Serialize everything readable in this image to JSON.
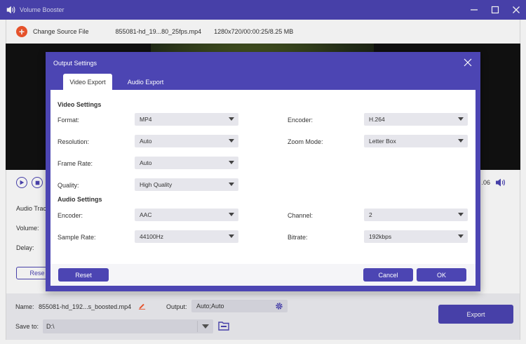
{
  "app": {
    "title": "Volume Booster",
    "source": {
      "change_label": "Change Source File",
      "file_name": "855081-hd_19...80_25fps.mp4",
      "file_meta": "1280x720/00:00:25/8.25 MB"
    },
    "controls": {
      "time_right": ".06"
    },
    "settings": {
      "audio_track_label": "Audio Trac",
      "volume_label": "Volume:",
      "delay_label": "Delay:",
      "reset_label": "Rese"
    },
    "bottom": {
      "name_label": "Name:",
      "name_value": "855081-hd_192...s_boosted.mp4",
      "output_label": "Output:",
      "output_value": "Auto;Auto",
      "saveto_label": "Save to:",
      "saveto_value": "D:\\",
      "export_label": "Export"
    }
  },
  "dialog": {
    "title": "Output Settings",
    "tabs": [
      {
        "label": "Video Export",
        "active": true
      },
      {
        "label": "Audio Export",
        "active": false
      }
    ],
    "video_settings": {
      "title": "Video Settings",
      "format": {
        "label": "Format:",
        "value": "MP4"
      },
      "encoder": {
        "label": "Encoder:",
        "value": "H.264"
      },
      "resolution": {
        "label": "Resolution:",
        "value": "Auto"
      },
      "zoom_mode": {
        "label": "Zoom Mode:",
        "value": "Letter Box"
      },
      "frame_rate": {
        "label": "Frame Rate:",
        "value": "Auto"
      },
      "quality": {
        "label": "Quality:",
        "value": "High Quality"
      }
    },
    "audio_settings": {
      "title": "Audio Settings",
      "encoder": {
        "label": "Encoder:",
        "value": "AAC"
      },
      "channel": {
        "label": "Channel:",
        "value": "2"
      },
      "sample_rate": {
        "label": "Sample Rate:",
        "value": "44100Hz"
      },
      "bitrate": {
        "label": "Bitrate:",
        "value": "192kbps"
      }
    },
    "buttons": {
      "reset": "Reset",
      "cancel": "Cancel",
      "ok": "OK"
    }
  },
  "colors": {
    "accent": "#4c45b3",
    "add_button": "#f4582e"
  }
}
